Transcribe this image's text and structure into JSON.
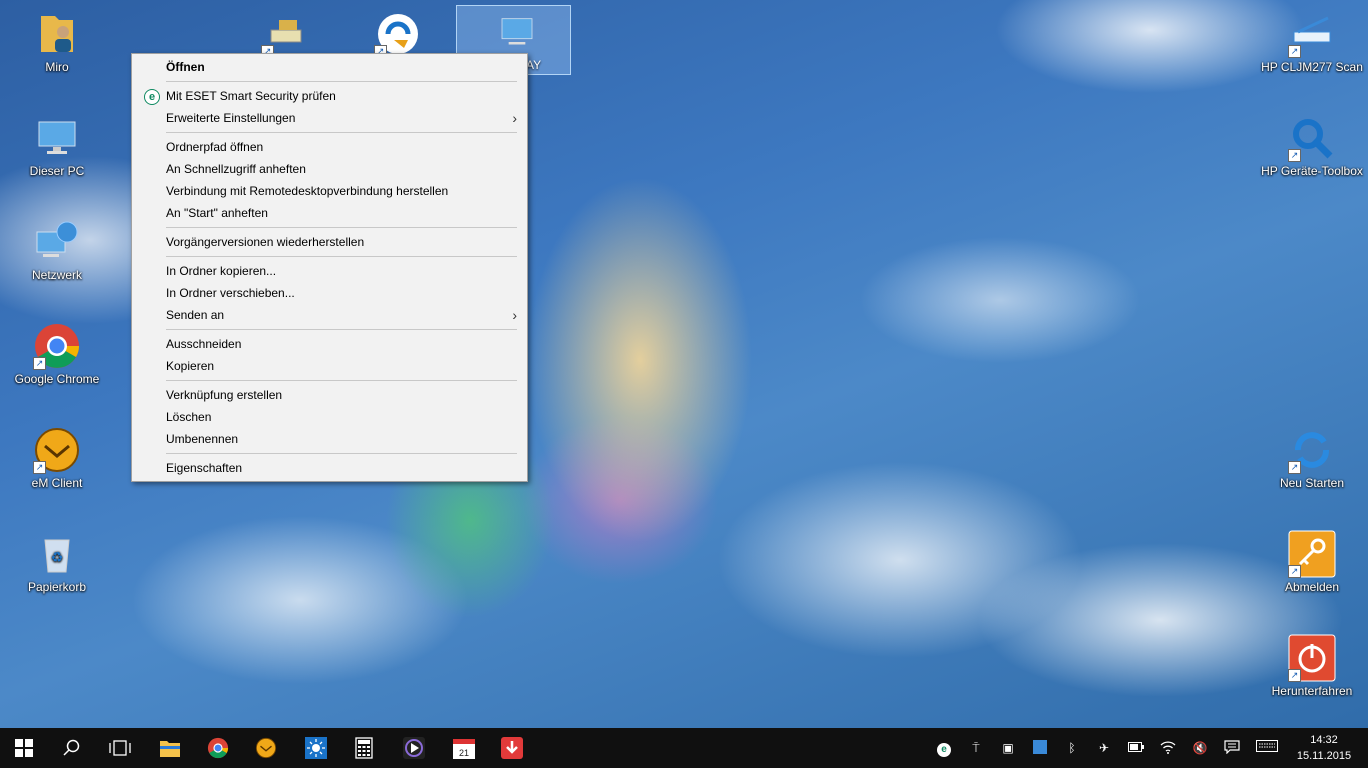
{
  "desktop_left": [
    {
      "name": "Miro"
    },
    {
      "name": "Dieser PC"
    },
    {
      "name": "Netzwerk"
    },
    {
      "name": "Google Chrome"
    },
    {
      "name": "eM Client"
    },
    {
      "name": "Papierkorb"
    }
  ],
  "desktop_right": [
    {
      "name": "HP CLJM277 Scan"
    },
    {
      "name": "HP Geräte-Toolbox"
    },
    {
      "name": "Neu Starten"
    },
    {
      "name": "Abmelden"
    },
    {
      "name": "Herunterfahren"
    }
  ],
  "selected_icon_partial_label": "AY",
  "context_menu": {
    "open": "Öffnen",
    "eset": "Mit ESET Smart Security prüfen",
    "advanced": "Erweiterte Einstellungen",
    "open_path": "Ordnerpfad öffnen",
    "pin_quick": "An Schnellzugriff anheften",
    "remote": "Verbindung mit Remotedesktopverbindung herstellen",
    "pin_start": "An \"Start\" anheften",
    "restore": "Vorgängerversionen wiederherstellen",
    "copy_to": "In Ordner kopieren...",
    "move_to": "In Ordner verschieben...",
    "send_to": "Senden an",
    "cut": "Ausschneiden",
    "copy": "Kopieren",
    "shortcut": "Verknüpfung erstellen",
    "delete": "Löschen",
    "rename": "Umbenennen",
    "properties": "Eigenschaften"
  },
  "clock": {
    "time": "14:32",
    "date": "15.11.2015"
  },
  "colors": {
    "taskbar": "#101010",
    "menu_bg": "#f2f2f2",
    "accent": "#1a5fb4"
  }
}
